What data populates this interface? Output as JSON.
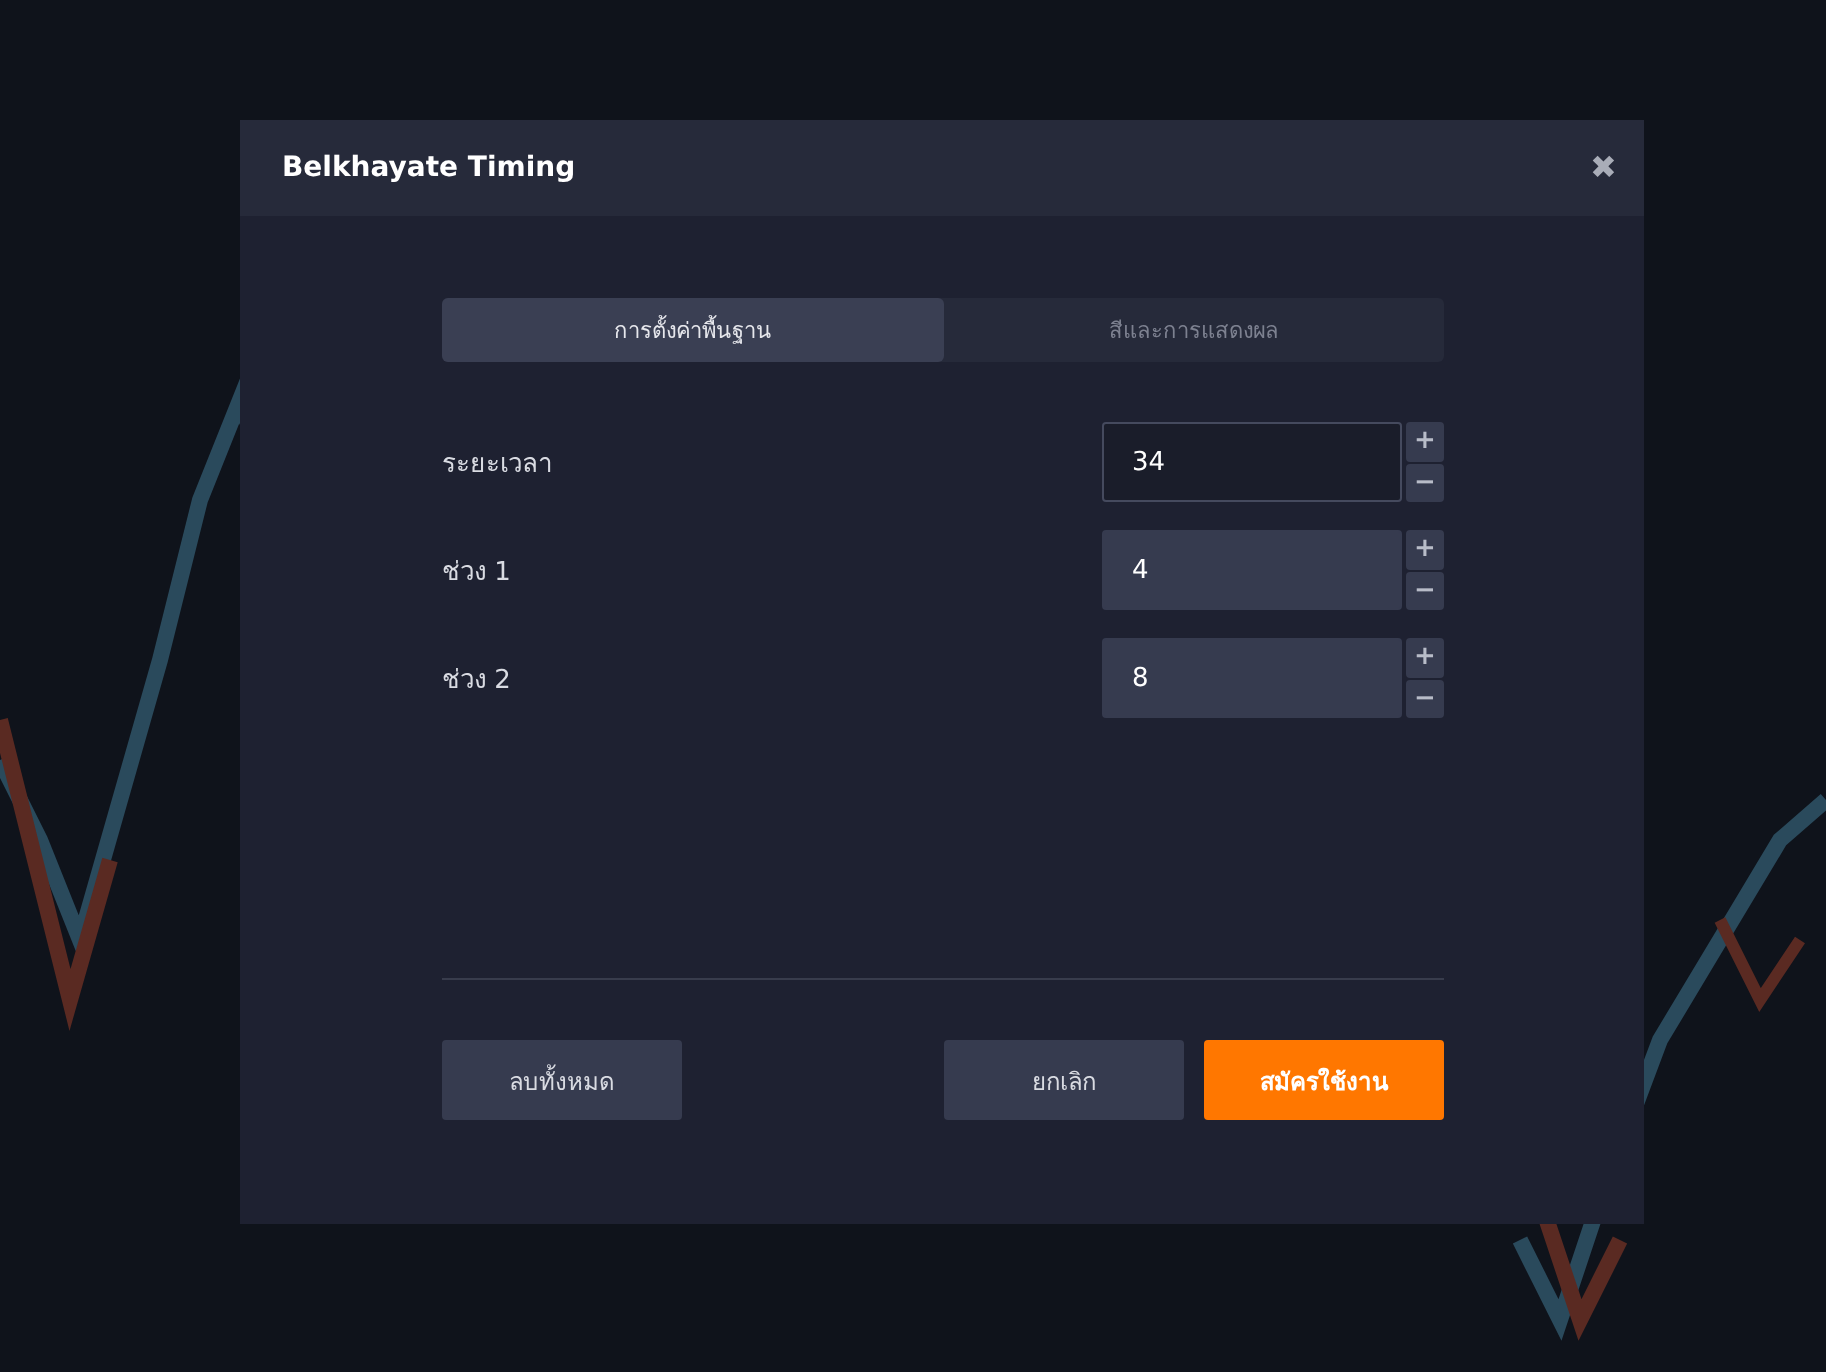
{
  "dialog": {
    "title": "Belkhayate Timing",
    "close": "✖"
  },
  "tabs": [
    {
      "label": "การตั้งค่าพื้นฐาน",
      "selected": true
    },
    {
      "label": "สีและการแสดงผล",
      "selected": false
    }
  ],
  "fields": [
    {
      "label": "ระยะเวลา",
      "value": "34",
      "focused": true,
      "increment": "+",
      "decrement": "−"
    },
    {
      "label": "ช่วง 1",
      "value": "4",
      "focused": false,
      "increment": "+",
      "decrement": "−"
    },
    {
      "label": "ช่วง 2",
      "value": "8",
      "focused": false,
      "increment": "+",
      "decrement": "−"
    }
  ],
  "buttons": [
    {
      "label": "ลบทั้งหมด",
      "kind": "secondary"
    },
    {
      "label": "ยกเลิก",
      "kind": "secondary"
    },
    {
      "label": "สมัครใช้งาน",
      "kind": "primary"
    }
  ]
}
